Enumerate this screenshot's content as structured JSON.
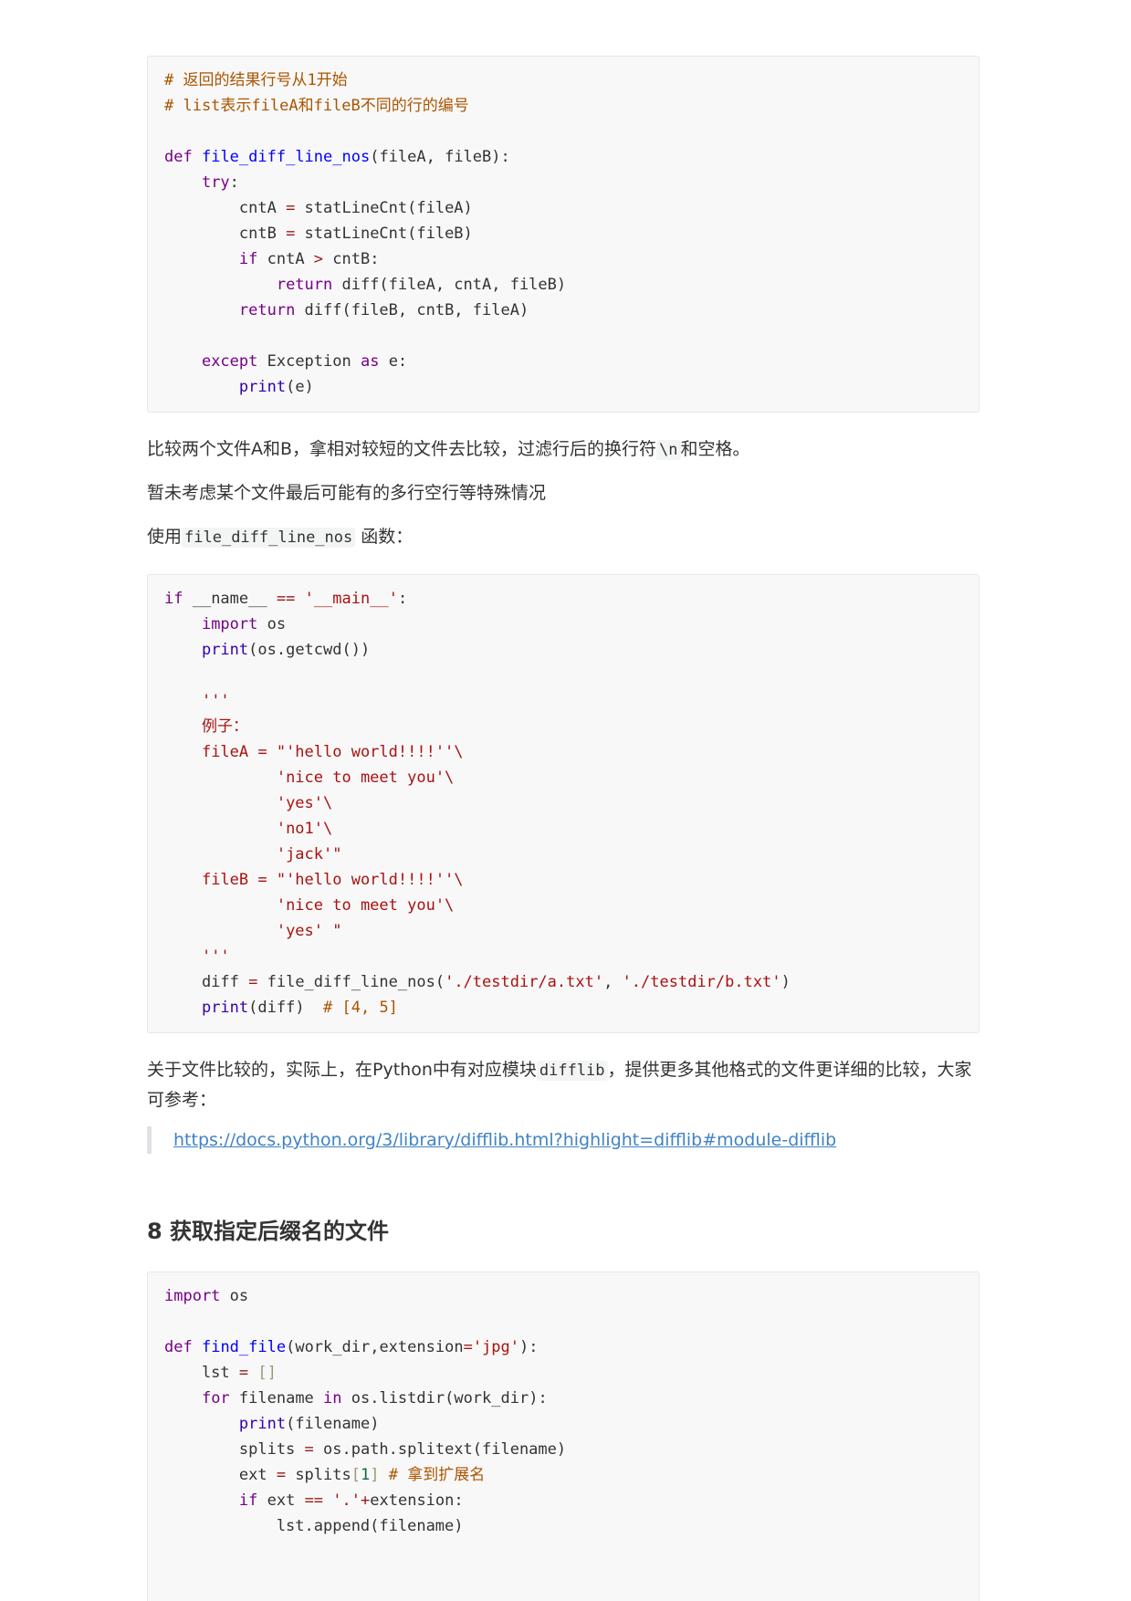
{
  "code_block_1": {
    "lines": [
      [
        [
          "com",
          "# 返回的结果行号从1开始"
        ]
      ],
      [
        [
          "com",
          "# list表示fileA和fileB不同的行的编号"
        ]
      ],
      [],
      [
        [
          "kw",
          "def"
        ],
        [
          "",
          " "
        ],
        [
          "def",
          "file_diff_line_nos"
        ],
        [
          "",
          "(fileA, fileB):"
        ]
      ],
      [
        [
          "",
          "    "
        ],
        [
          "kw",
          "try"
        ],
        [
          "",
          ":"
        ]
      ],
      [
        [
          "",
          "        cntA "
        ],
        [
          "op",
          "="
        ],
        [
          "",
          " statLineCnt(fileA)"
        ]
      ],
      [
        [
          "",
          "        cntB "
        ],
        [
          "op",
          "="
        ],
        [
          "",
          " statLineCnt(fileB)"
        ]
      ],
      [
        [
          "",
          "        "
        ],
        [
          "kw",
          "if"
        ],
        [
          "",
          " cntA "
        ],
        [
          "op",
          ">"
        ],
        [
          "",
          " cntB:"
        ]
      ],
      [
        [
          "",
          "            "
        ],
        [
          "kw",
          "return"
        ],
        [
          "",
          " diff(fileA, cntA, fileB)"
        ]
      ],
      [
        [
          "",
          "        "
        ],
        [
          "kw",
          "return"
        ],
        [
          "",
          " diff(fileB, cntB, fileA)"
        ]
      ],
      [],
      [
        [
          "",
          "    "
        ],
        [
          "kw",
          "except"
        ],
        [
          "",
          " Exception "
        ],
        [
          "kw",
          "as"
        ],
        [
          "",
          " e:"
        ]
      ],
      [
        [
          "",
          "        "
        ],
        [
          "bi",
          "print"
        ],
        [
          "",
          "(e)"
        ]
      ]
    ]
  },
  "paragraphs": {
    "p1_text": "比较两个文件A和B，拿相对较短的文件去比较，过滤行后的换行符",
    "p1_code": "\\n",
    "p1_tail": "和空格。",
    "p2": "暂未考虑某个文件最后可能有的多行空行等特殊情况",
    "p3_text": "使用",
    "p3_code": "file_diff_line_nos",
    "p3_tail": " 函数：",
    "p4_text": "关于文件比较的，实际上，在Python中有对应模块",
    "p4_code": "difflib",
    "p4_tail": "，提供更多其他格式的文件更详细的比较，大家可参考："
  },
  "code_block_2": {
    "lines": [
      [
        [
          "kw",
          "if"
        ],
        [
          "",
          " __name__ "
        ],
        [
          "op",
          "=="
        ],
        [
          "",
          " "
        ],
        [
          "str",
          "'__main__'"
        ],
        [
          "",
          ":"
        ]
      ],
      [
        [
          "",
          "    "
        ],
        [
          "kw",
          "import"
        ],
        [
          "",
          " os"
        ]
      ],
      [
        [
          "",
          "    "
        ],
        [
          "bi",
          "print"
        ],
        [
          "",
          "(os.getcwd())"
        ]
      ],
      [],
      [
        [
          "",
          "    "
        ],
        [
          "str",
          "'''"
        ]
      ],
      [
        [
          "",
          "    "
        ],
        [
          "str",
          "例子："
        ]
      ],
      [
        [
          "",
          "    "
        ],
        [
          "str",
          "fileA = \"'hello world!!!!''\\"
        ]
      ],
      [
        [
          "",
          "            "
        ],
        [
          "str",
          "'nice to meet you'\\"
        ]
      ],
      [
        [
          "",
          "            "
        ],
        [
          "str",
          "'yes'\\"
        ]
      ],
      [
        [
          "",
          "            "
        ],
        [
          "str",
          "'no1'\\"
        ]
      ],
      [
        [
          "",
          "            "
        ],
        [
          "str",
          "'jack'\""
        ]
      ],
      [
        [
          "",
          "    "
        ],
        [
          "str",
          "fileB = \"'hello world!!!!''\\"
        ]
      ],
      [
        [
          "",
          "            "
        ],
        [
          "str",
          "'nice to meet you'\\"
        ]
      ],
      [
        [
          "",
          "            "
        ],
        [
          "str",
          "'yes' \""
        ]
      ],
      [
        [
          "",
          "    "
        ],
        [
          "str",
          "'''"
        ]
      ],
      [
        [
          "",
          "    diff "
        ],
        [
          "op",
          "="
        ],
        [
          "",
          " file_diff_line_nos("
        ],
        [
          "str",
          "'./testdir/a.txt'"
        ],
        [
          "",
          ", "
        ],
        [
          "str",
          "'./testdir/b.txt'"
        ],
        [
          "",
          ")"
        ]
      ],
      [
        [
          "",
          "    "
        ],
        [
          "bi",
          "print"
        ],
        [
          "",
          "(diff)  "
        ],
        [
          "com",
          "# [4, 5]"
        ]
      ]
    ]
  },
  "link": {
    "text": "https://docs.python.org/3/library/difflib.html?highlight=difflib#module-difflib"
  },
  "heading": "8 获取指定后缀名的文件",
  "code_block_3": {
    "lines": [
      [
        [
          "kw",
          "import"
        ],
        [
          "",
          " os"
        ]
      ],
      [],
      [
        [
          "kw",
          "def"
        ],
        [
          "",
          " "
        ],
        [
          "def",
          "find_file"
        ],
        [
          "",
          "(work_dir,extension"
        ],
        [
          "op",
          "="
        ],
        [
          "str",
          "'jpg'"
        ],
        [
          "",
          "):"
        ]
      ],
      [
        [
          "",
          "    lst "
        ],
        [
          "op",
          "="
        ],
        [
          "",
          " "
        ],
        [
          "bra",
          "[]"
        ]
      ],
      [
        [
          "",
          "    "
        ],
        [
          "kw",
          "for"
        ],
        [
          "",
          " filename "
        ],
        [
          "kw",
          "in"
        ],
        [
          "",
          " os.listdir(work_dir):"
        ]
      ],
      [
        [
          "",
          "        "
        ],
        [
          "bi",
          "print"
        ],
        [
          "",
          "(filename)"
        ]
      ],
      [
        [
          "",
          "        splits "
        ],
        [
          "op",
          "="
        ],
        [
          "",
          " os.path.splitext(filename)"
        ]
      ],
      [
        [
          "",
          "        ext "
        ],
        [
          "op",
          "="
        ],
        [
          "",
          " splits"
        ],
        [
          "bra",
          "["
        ],
        [
          "num",
          "1"
        ],
        [
          "bra",
          "]"
        ],
        [
          "",
          " "
        ],
        [
          "com",
          "# 拿到扩展名"
        ]
      ],
      [
        [
          "",
          "        "
        ],
        [
          "kw",
          "if"
        ],
        [
          "",
          " ext "
        ],
        [
          "op",
          "=="
        ],
        [
          "",
          " "
        ],
        [
          "str",
          "'.'"
        ],
        [
          "op",
          "+"
        ],
        [
          "",
          "extension:"
        ]
      ],
      [
        [
          "",
          "            lst.append(filename)"
        ]
      ]
    ]
  }
}
